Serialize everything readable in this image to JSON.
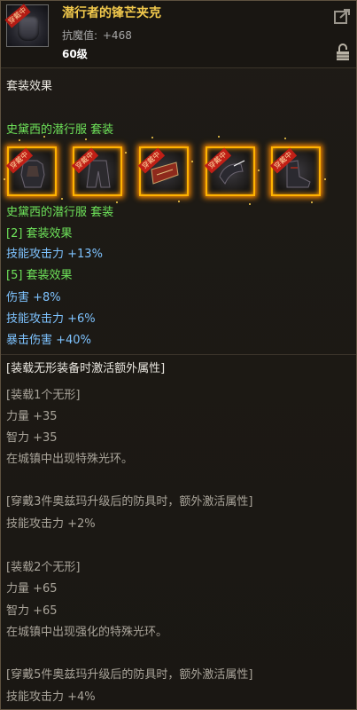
{
  "header": {
    "item_name": "潜行者的锋芒夹克",
    "stat_label": "抗魔值:",
    "stat_value": "+468",
    "level": "60级",
    "item_badge": "穿戴中"
  },
  "set_effect_title": "套装效果",
  "set_name": "史黛西的潜行服 套装",
  "slots": [
    {
      "badge": "穿戴中",
      "icon": "dark-armor-icon"
    },
    {
      "badge": "穿戴中",
      "icon": "dark-pants-icon"
    },
    {
      "badge": "穿戴中",
      "icon": "red-belt-icon"
    },
    {
      "badge": "穿戴中",
      "icon": "dark-shoulder-icon"
    },
    {
      "badge": "穿戴中",
      "icon": "dark-boots-icon"
    }
  ],
  "set_name_2": "史黛西的潜行服 套装",
  "bonus_2_label": "[2] 套装效果",
  "bonus_2_stat": "技能攻击力 +13%",
  "bonus_5_label": "[5] 套装效果",
  "bonus_5_stats": [
    "伤害 +8%",
    "技能攻击力 +6%",
    "暴击伤害 +40%"
  ],
  "invisible": {
    "title": "[装载无形装备时激活额外属性]",
    "block1_title": "[装载1个无形]",
    "block1_lines": [
      "力量 +35",
      "智力 +35",
      "在城镇中出现特殊光环。"
    ],
    "block2_title": "[穿戴3件奥兹玛升级后的防具时，额外激活属性]",
    "block2_lines": [
      "技能攻击力 +2%"
    ],
    "block3_title": "[装载2个无形]",
    "block3_lines": [
      "力量 +65",
      "智力 +65",
      "在城镇中出现强化的特殊光环。"
    ],
    "block4_title": "[穿戴5件奥兹玛升级后的防具时，额外激活属性]",
    "block4_lines": [
      "技能攻击力 +4%"
    ]
  },
  "colors": {
    "item_name": "#f2c94c",
    "set_green": "#6ee35a",
    "stat_blue": "#7ec3ff",
    "slot_glow": "#ff8c00"
  }
}
